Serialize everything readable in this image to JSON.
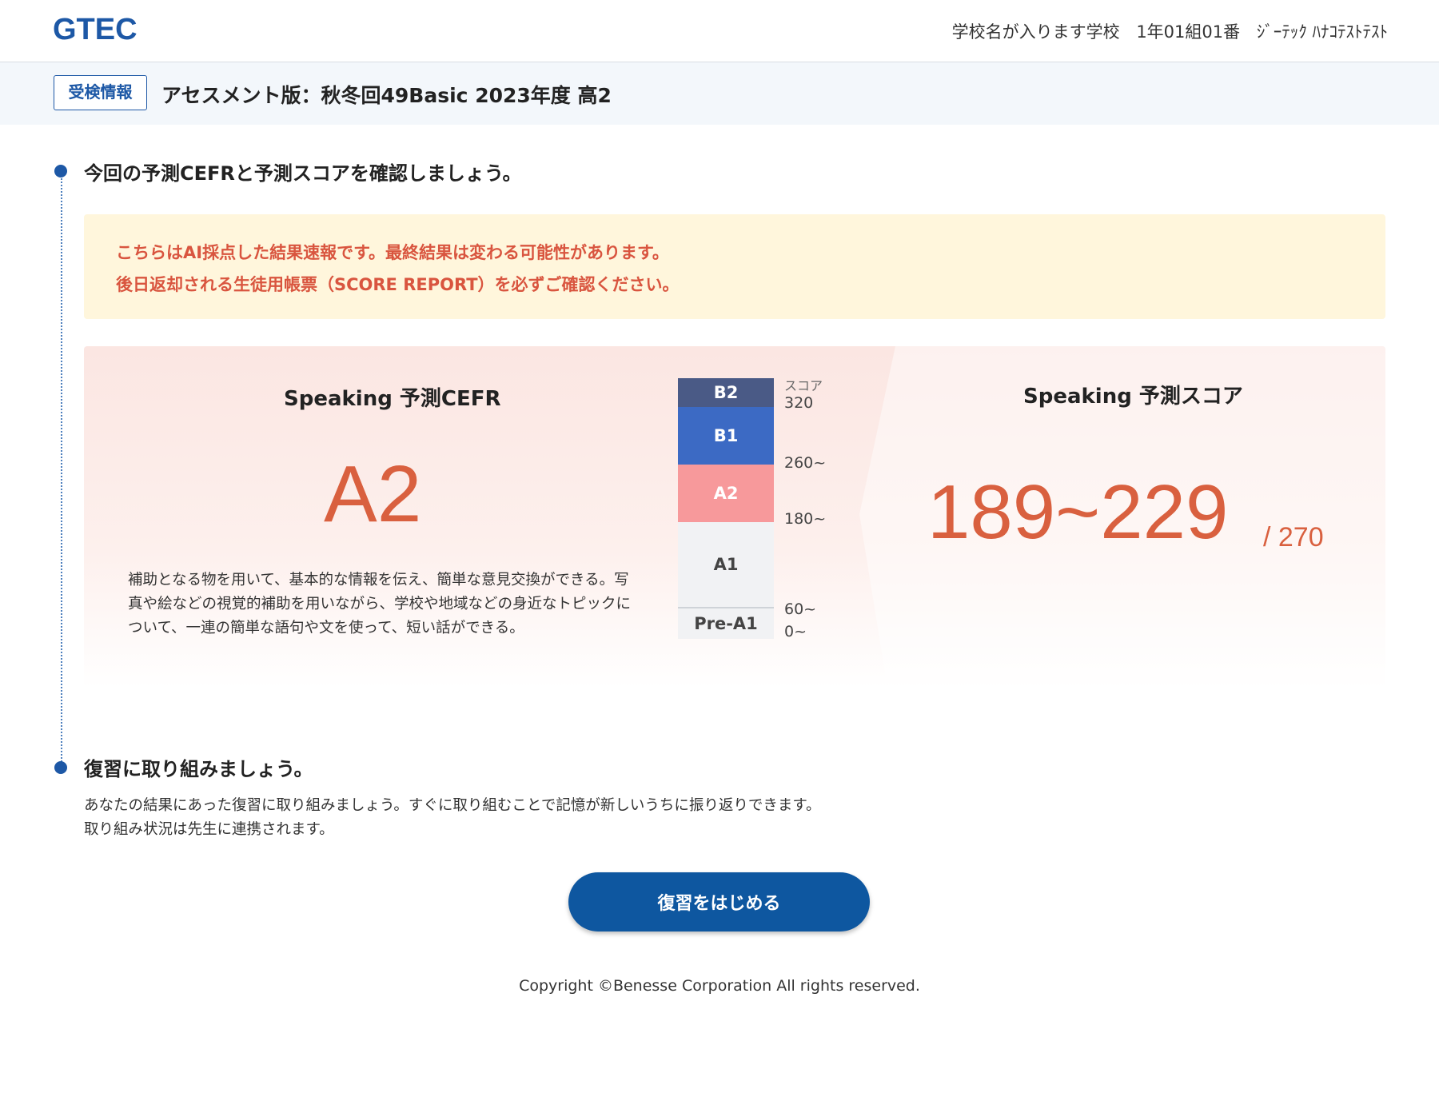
{
  "header": {
    "logo": "GTEC",
    "school": "学校名が入ります学校",
    "class_info": "1年01組01番",
    "student_name": "ｼﾞｰﾃｯｸ ﾊﾅｺﾃｽﾄﾃｽﾄ"
  },
  "exam": {
    "badge": "受検情報",
    "title": "アセスメント版：秋冬回49Basic 2023年度 高2"
  },
  "section1": {
    "title": "今回の予測CEFRと予測スコアを確認しましょう。"
  },
  "notice": {
    "line1": "こちらはAI採点した結果速報です。最終結果は変わる可能性があります。",
    "line2": "後日返却される生徒用帳票（SCORE REPORT）を必ずご確認ください。"
  },
  "cefr": {
    "title": "Speaking 予測CEFR",
    "value": "A2",
    "description": "補助となる物を用いて、基本的な情報を伝え、簡単な意見交換ができる。写真や絵などの視覚的補助を用いながら、学校や地域などの身近なトピックについて、一連の簡単な語句や文を使って、短い話ができる。"
  },
  "scale": {
    "header": "スコア",
    "bands": [
      {
        "label": "B2",
        "color": "#4a5a86",
        "text_color": "#ffffff"
      },
      {
        "label": "B1",
        "color": "#3c6ac4",
        "text_color": "#ffffff"
      },
      {
        "label": "A2",
        "color": "#f7999b",
        "text_color": "#ffffff"
      },
      {
        "label": "A1",
        "color": "#f1f2f4",
        "text_color": "#444444"
      },
      {
        "label": "Pre-A1",
        "color": "#f1f2f4",
        "text_color": "#444444"
      }
    ],
    "ticks": [
      "320",
      "260~",
      "180~",
      "60~",
      "0~"
    ]
  },
  "score": {
    "title": "Speaking 予測スコア",
    "range": "189~229",
    "max": "/ 270"
  },
  "section2": {
    "title": "復習に取り組みましょう。",
    "desc_line1": "あなたの結果にあった復習に取り組みましょう。すぐに取り組むことで記憶が新しいうちに振り返りできます。",
    "desc_line2": "取り組み状況は先生に連携されます。",
    "button_label": "復習をはじめる"
  },
  "footer": {
    "copyright": "Copyright ©Benesse Corporation All rights reserved."
  },
  "colors": {
    "brand": "#1d58a6",
    "accent": "#d9603f",
    "notice_bg": "#fff6dc",
    "notice_text": "#d9553f",
    "button": "#0e57a0"
  }
}
